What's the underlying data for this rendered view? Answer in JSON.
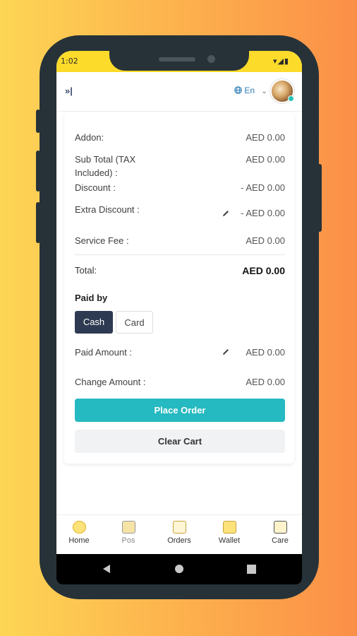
{
  "status": {
    "time": "1:02",
    "icons": "▾◢▮"
  },
  "appbar": {
    "collapse_icon": "»|",
    "lang_icon": "globe-icon",
    "lang": "En",
    "lang_chevron": "⌄"
  },
  "summary": {
    "addon_label": "Addon:",
    "addon_value": "AED 0.00",
    "subtotal_label_1": "Sub Total (TAX",
    "subtotal_label_2": "Included) :",
    "subtotal_value": "AED 0.00",
    "discount_label": "Discount :",
    "discount_value": "- AED 0.00",
    "extra_discount_label": "Extra Discount :",
    "extra_discount_value": "- AED 0.00",
    "service_fee_label": "Service Fee :",
    "service_fee_value": "AED 0.00",
    "total_label": "Total:",
    "total_value": "AED 0.00"
  },
  "payment": {
    "paid_by_label": "Paid by",
    "options": [
      "Cash",
      "Card"
    ],
    "selected": "Cash",
    "paid_amount_label": "Paid Amount :",
    "paid_amount_value": "AED 0.00",
    "change_amount_label": "Change Amount :",
    "change_amount_value": "AED 0.00"
  },
  "actions": {
    "place_order": "Place Order",
    "clear_cart": "Clear Cart"
  },
  "nav": {
    "items": [
      "Home",
      "Pos",
      "Orders",
      "Wallet",
      "Care"
    ]
  },
  "colors": {
    "accent": "#25b9c1",
    "selected_bg": "#2e3a51",
    "status_bar": "#fddb2a"
  }
}
